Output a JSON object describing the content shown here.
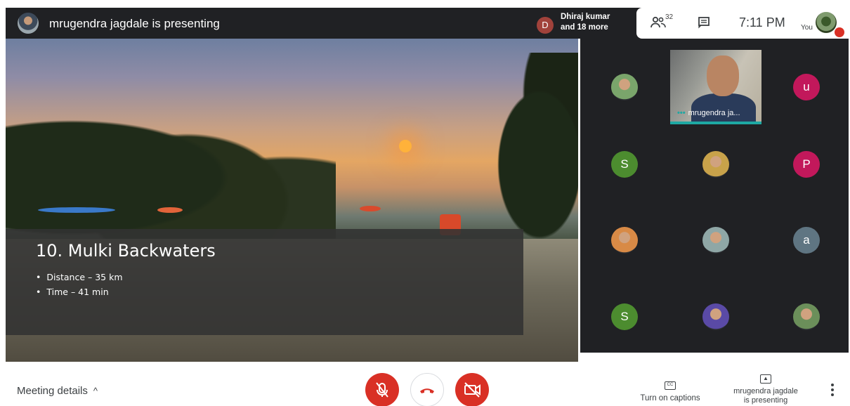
{
  "header": {
    "presenting_title": "mrugendra jagdale is presenting",
    "joiner_initial": "D",
    "joiner_line1": "Dhiraj kumar",
    "joiner_line2": "and 18 more",
    "people_count": "32",
    "time": "7:11 PM",
    "you_label": "You"
  },
  "slide": {
    "title": "10. Mulki Backwaters",
    "bullets": [
      "Distance – 35 km",
      "Time – 41 min"
    ]
  },
  "participants": {
    "main_video_name": "mrugendra ja...",
    "tiles": [
      {
        "type": "photo",
        "color": "#7aa56b"
      },
      {
        "type": "initial",
        "letter": "u",
        "color": "#c2185b"
      },
      {
        "type": "initial",
        "letter": "S",
        "color": "#4c8c2f"
      },
      {
        "type": "photo",
        "color": "#c8a24a"
      },
      {
        "type": "initial",
        "letter": "P",
        "color": "#c2185b"
      },
      {
        "type": "photo",
        "color": "#d88a46"
      },
      {
        "type": "photo",
        "color": "#8fa7a6"
      },
      {
        "type": "initial",
        "letter": "a",
        "color": "#5f7582"
      },
      {
        "type": "initial",
        "letter": "S",
        "color": "#4c8c2f"
      },
      {
        "type": "photo",
        "color": "#5a4aa6"
      },
      {
        "type": "photo",
        "color": "#6b8f5a"
      }
    ]
  },
  "footer": {
    "meeting_details": "Meeting details",
    "captions_label": "Turn on captions",
    "present_label_line1": "mrugendra jagdale",
    "present_label_line2": "is presenting"
  },
  "colors": {
    "danger": "#d93025",
    "dark": "#202124",
    "accent": "#1ea8a3"
  }
}
